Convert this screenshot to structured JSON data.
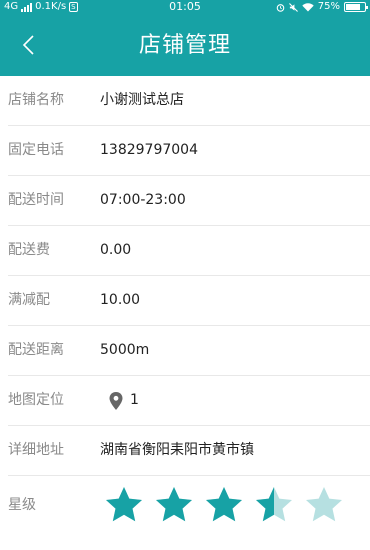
{
  "status_bar": {
    "network": "4G",
    "speed": "0.1K/s",
    "sim_badge": "S",
    "time": "01:05",
    "battery_text": "75%",
    "battery_level": 0.75
  },
  "header": {
    "title": "店铺管理",
    "back_icon": "chevron-left-icon"
  },
  "rows": [
    {
      "label": "店铺名称",
      "value": "小谢测试总店"
    },
    {
      "label": "固定电话",
      "value": "13829797004"
    },
    {
      "label": "配送时间",
      "value": "07:00-23:00"
    },
    {
      "label": "配送费",
      "value": "0.00"
    },
    {
      "label": "满减配",
      "value": "10.00"
    },
    {
      "label": "配送距离",
      "value": "5000m"
    }
  ],
  "location": {
    "label": "地图定位",
    "value": "1",
    "icon": "map-pin-icon"
  },
  "address": {
    "label": "详细地址",
    "value": "湖南省衡阳耒阳市黄市镇"
  },
  "rating": {
    "label": "星级",
    "value": 3.5,
    "max": 5
  },
  "colors": {
    "primary": "#17a2a5",
    "star_filled": "#17a2a5",
    "star_empty": "#b6e0e1",
    "label_text": "#8a8a8a",
    "value_text": "#222222"
  }
}
